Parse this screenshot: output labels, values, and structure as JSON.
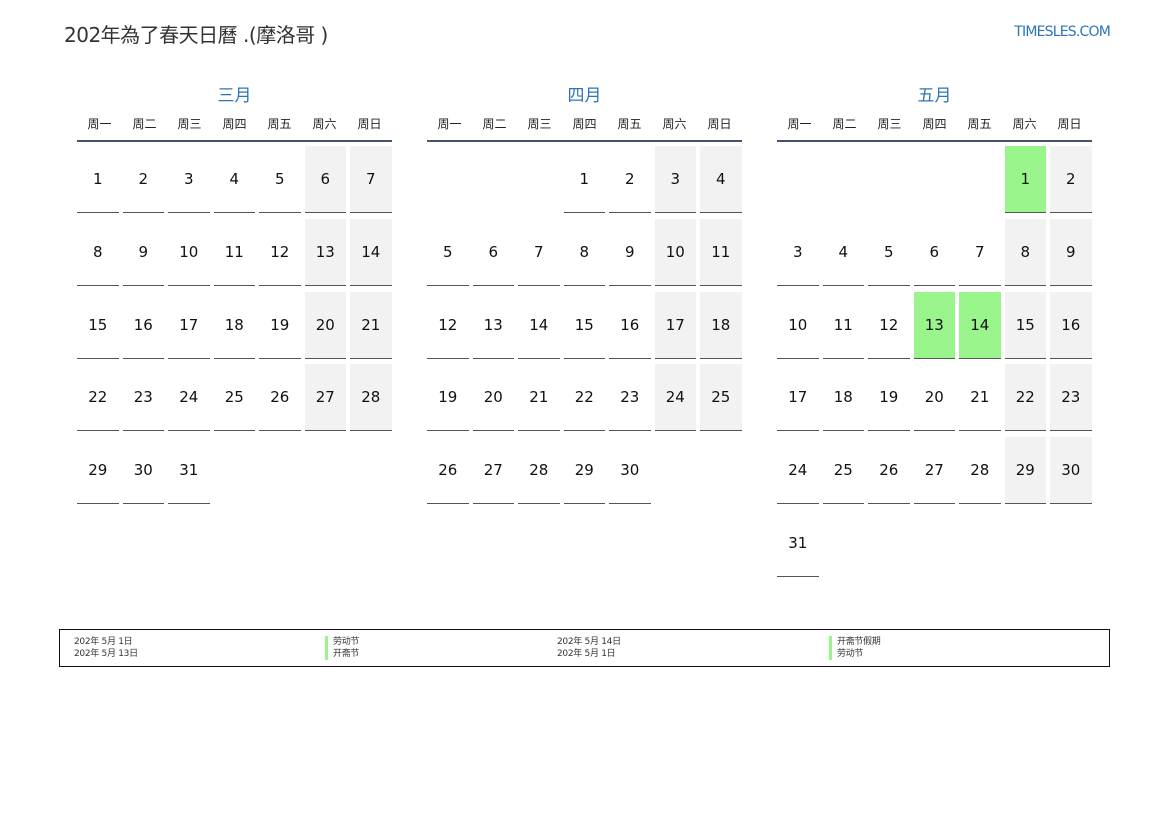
{
  "title": "202年為了春天日曆 .(摩洛哥 )",
  "site": "TIMESLES.COM",
  "weekdays": [
    "周一",
    "周二",
    "周三",
    "周四",
    "周五",
    "周六",
    "周日"
  ],
  "months": [
    {
      "name": "三月",
      "weeks": [
        [
          "1",
          "2",
          "3",
          "4",
          "5",
          "6",
          "7"
        ],
        [
          "8",
          "9",
          "10",
          "11",
          "12",
          "13",
          "14"
        ],
        [
          "15",
          "16",
          "17",
          "18",
          "19",
          "20",
          "21"
        ],
        [
          "22",
          "23",
          "24",
          "25",
          "26",
          "27",
          "28"
        ],
        [
          "29",
          "30",
          "31",
          "",
          "",
          "",
          ""
        ]
      ],
      "holidays": []
    },
    {
      "name": "四月",
      "weeks": [
        [
          "",
          "",
          "",
          "1",
          "2",
          "3",
          "4"
        ],
        [
          "5",
          "6",
          "7",
          "8",
          "9",
          "10",
          "11"
        ],
        [
          "12",
          "13",
          "14",
          "15",
          "16",
          "17",
          "18"
        ],
        [
          "19",
          "20",
          "21",
          "22",
          "23",
          "24",
          "25"
        ],
        [
          "26",
          "27",
          "28",
          "29",
          "30",
          "",
          ""
        ]
      ],
      "holidays": []
    },
    {
      "name": "五月",
      "weeks": [
        [
          "",
          "",
          "",
          "",
          "",
          "1",
          "2"
        ],
        [
          "3",
          "4",
          "5",
          "6",
          "7",
          "8",
          "9"
        ],
        [
          "10",
          "11",
          "12",
          "13",
          "14",
          "15",
          "16"
        ],
        [
          "17",
          "18",
          "19",
          "20",
          "21",
          "22",
          "23"
        ],
        [
          "24",
          "25",
          "26",
          "27",
          "28",
          "29",
          "30"
        ],
        [
          "31",
          "",
          "",
          "",
          "",
          "",
          ""
        ]
      ],
      "holidays": [
        "1",
        "13",
        "14"
      ]
    }
  ],
  "holiday_color": "#99f48b",
  "accent_color": "#2e75b6",
  "legend": {
    "col1_dates": [
      "202年 5月 1日",
      "202年 5月 13日"
    ],
    "col1_names": [
      "劳动节",
      "开斋节"
    ],
    "col2_dates": [
      "202年 5月 14日",
      "202年 5月 1日"
    ],
    "col2_names": [
      "开斋节假期",
      "劳动节"
    ]
  }
}
